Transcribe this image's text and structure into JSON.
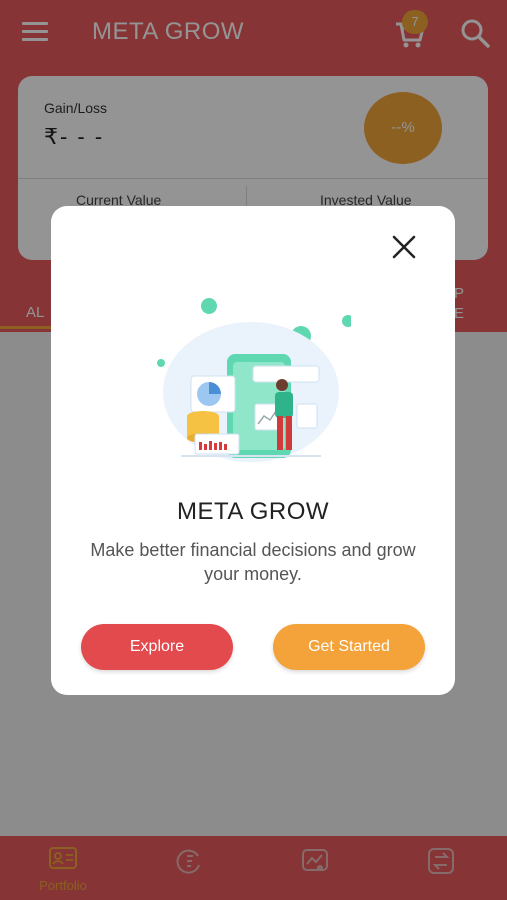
{
  "app_bar": {
    "title": "META GROW",
    "cart_count": "7",
    "icons": [
      "menu-icon",
      "cart-icon",
      "search-icon"
    ]
  },
  "portfolio_card": {
    "gain_loss_label": "Gain/Loss",
    "gain_loss_value": "₹- - -",
    "percent_value": "--%",
    "current_value_label": "Current Value",
    "invested_value_label": "Invested Value"
  },
  "tabs": {
    "first_partial": "AL",
    "last_partial_line1": "P",
    "last_partial_line2": "E"
  },
  "bottom_nav": {
    "items": [
      {
        "label": "Portfolio",
        "icon": "portfolio-icon",
        "active": true
      },
      {
        "label": "",
        "icon": "history-icon",
        "active": false
      },
      {
        "label": "",
        "icon": "chart-icon",
        "active": false
      },
      {
        "label": "",
        "icon": "transfer-icon",
        "active": false
      }
    ]
  },
  "modal": {
    "title": "META GROW",
    "description": "Make better financial decisions and grow your money.",
    "explore_label": "Explore",
    "get_started_label": "Get Started"
  },
  "colors": {
    "brand_red": "#e75a5c",
    "accent_orange": "#f0a53a",
    "explore_red": "#e24a4d",
    "get_started_orange": "#f4a23a"
  }
}
